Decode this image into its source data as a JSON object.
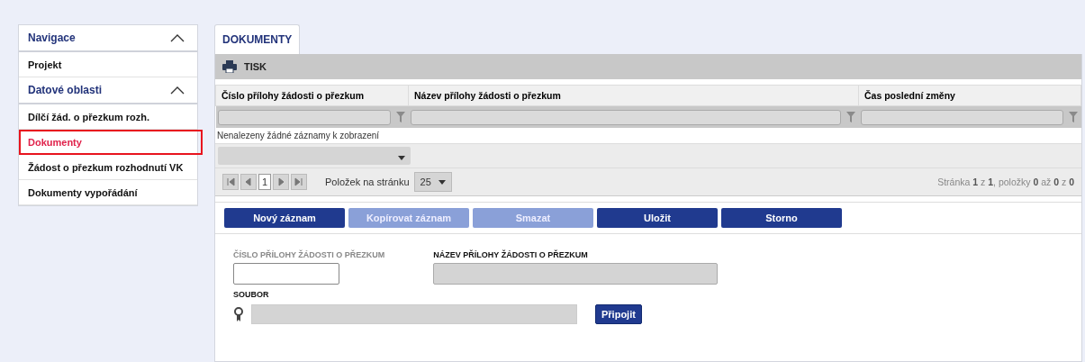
{
  "sidebar": {
    "sections": [
      {
        "title": "Navigace",
        "expanded": true,
        "items": [
          {
            "label": "Projekt",
            "selected": false
          }
        ]
      },
      {
        "title": "Datové oblasti",
        "expanded": true,
        "items": [
          {
            "label": "Dílčí žád. o přezkum rozh.",
            "selected": false
          },
          {
            "label": "Dokumenty",
            "selected": true
          },
          {
            "label": "Žádost o přezkum rozhodnutí VK",
            "selected": false
          },
          {
            "label": "Dokumenty vypořádání",
            "selected": false
          }
        ]
      }
    ]
  },
  "tabs": [
    {
      "label": "DOKUMENTY",
      "selected": true
    }
  ],
  "toolbar": {
    "print_label": "TISK"
  },
  "table": {
    "columns": [
      "Číslo přílohy žádosti o přezkum",
      "Název přílohy žádosti o přezkum",
      "Čas poslední změny"
    ],
    "empty_message": "Nenalezeny žádné záznamy k zobrazení"
  },
  "pager": {
    "page": "1",
    "per_page_label": "Položek na stránku",
    "per_page": "25",
    "status": "Stránka **1** z **1**, položky **0** až **0** z **0**"
  },
  "actions": [
    {
      "label": "Nový záznam",
      "disabled": false
    },
    {
      "label": "Kopírovat záznam",
      "disabled": true
    },
    {
      "label": "Smazat",
      "disabled": true
    },
    {
      "label": "Uložit",
      "disabled": false
    },
    {
      "label": "Storno",
      "disabled": false
    }
  ],
  "form": {
    "fields": [
      {
        "label": "ČÍSLO PŘÍLOHY ŽÁDOSTI O PŘEZKUM",
        "readonly": false,
        "label_dimmed": true
      },
      {
        "label": "NÁZEV PŘÍLOHY ŽÁDOSTI O PŘEZKUM",
        "readonly": true,
        "label_dimmed": false
      }
    ],
    "file": {
      "label": "SOUBOR",
      "button": "Připojit"
    }
  }
}
